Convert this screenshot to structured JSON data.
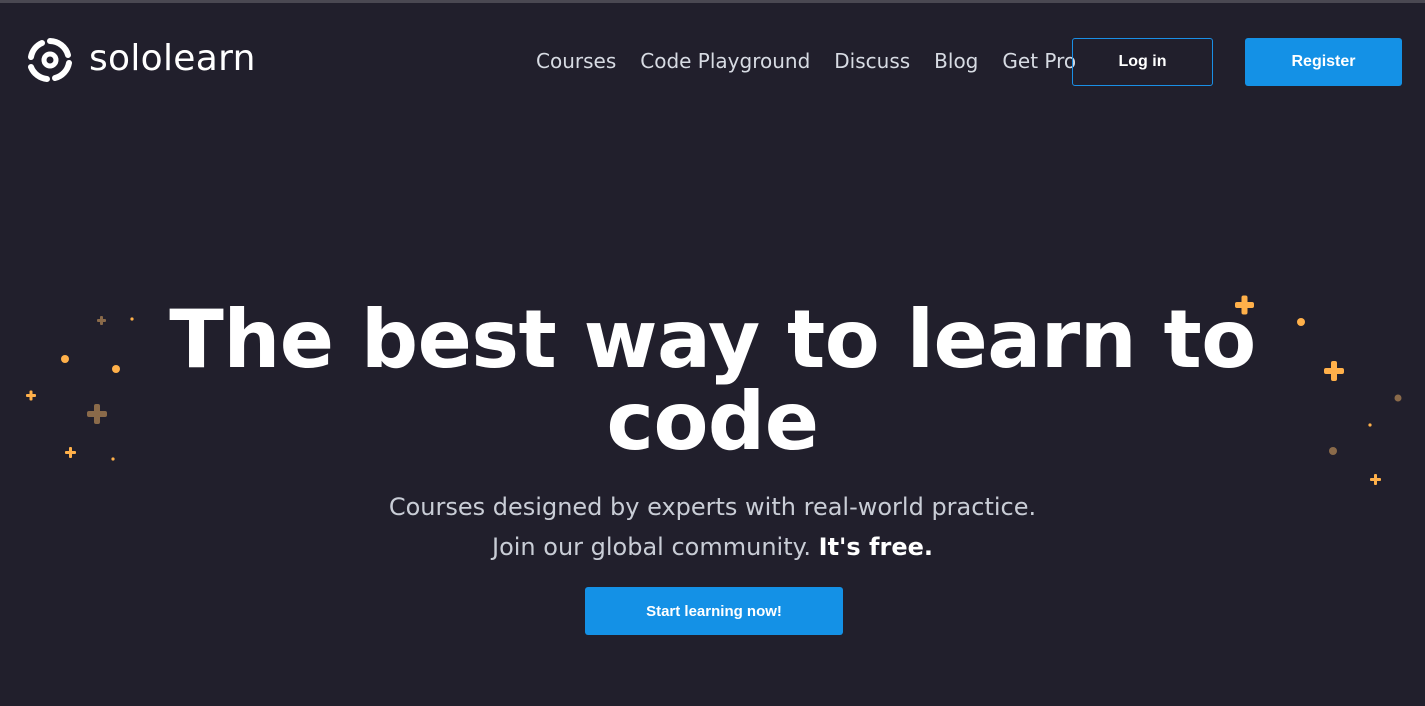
{
  "brand": {
    "name": "sololearn",
    "logo_icon": "sololearn-swirl-icon"
  },
  "nav": {
    "items": [
      {
        "label": "Courses"
      },
      {
        "label": "Code Playground"
      },
      {
        "label": "Discuss"
      },
      {
        "label": "Blog"
      },
      {
        "label": "Get Pro"
      }
    ],
    "login_label": "Log in",
    "register_label": "Register"
  },
  "hero": {
    "title_line1": "The best way to learn to",
    "title_line2": "code",
    "subtitle_line1": "Courses designed by experts with real-world practice.",
    "subtitle_line2_lead": "Join our global community.",
    "subtitle_line2_emphasis": "It's free.",
    "cta_label": "Start learning now!"
  },
  "colors": {
    "background": "#211f2c",
    "accent_blue": "#1491e6",
    "deco_orange": "#ffb04a",
    "deco_brown": "#8a6a4a"
  }
}
